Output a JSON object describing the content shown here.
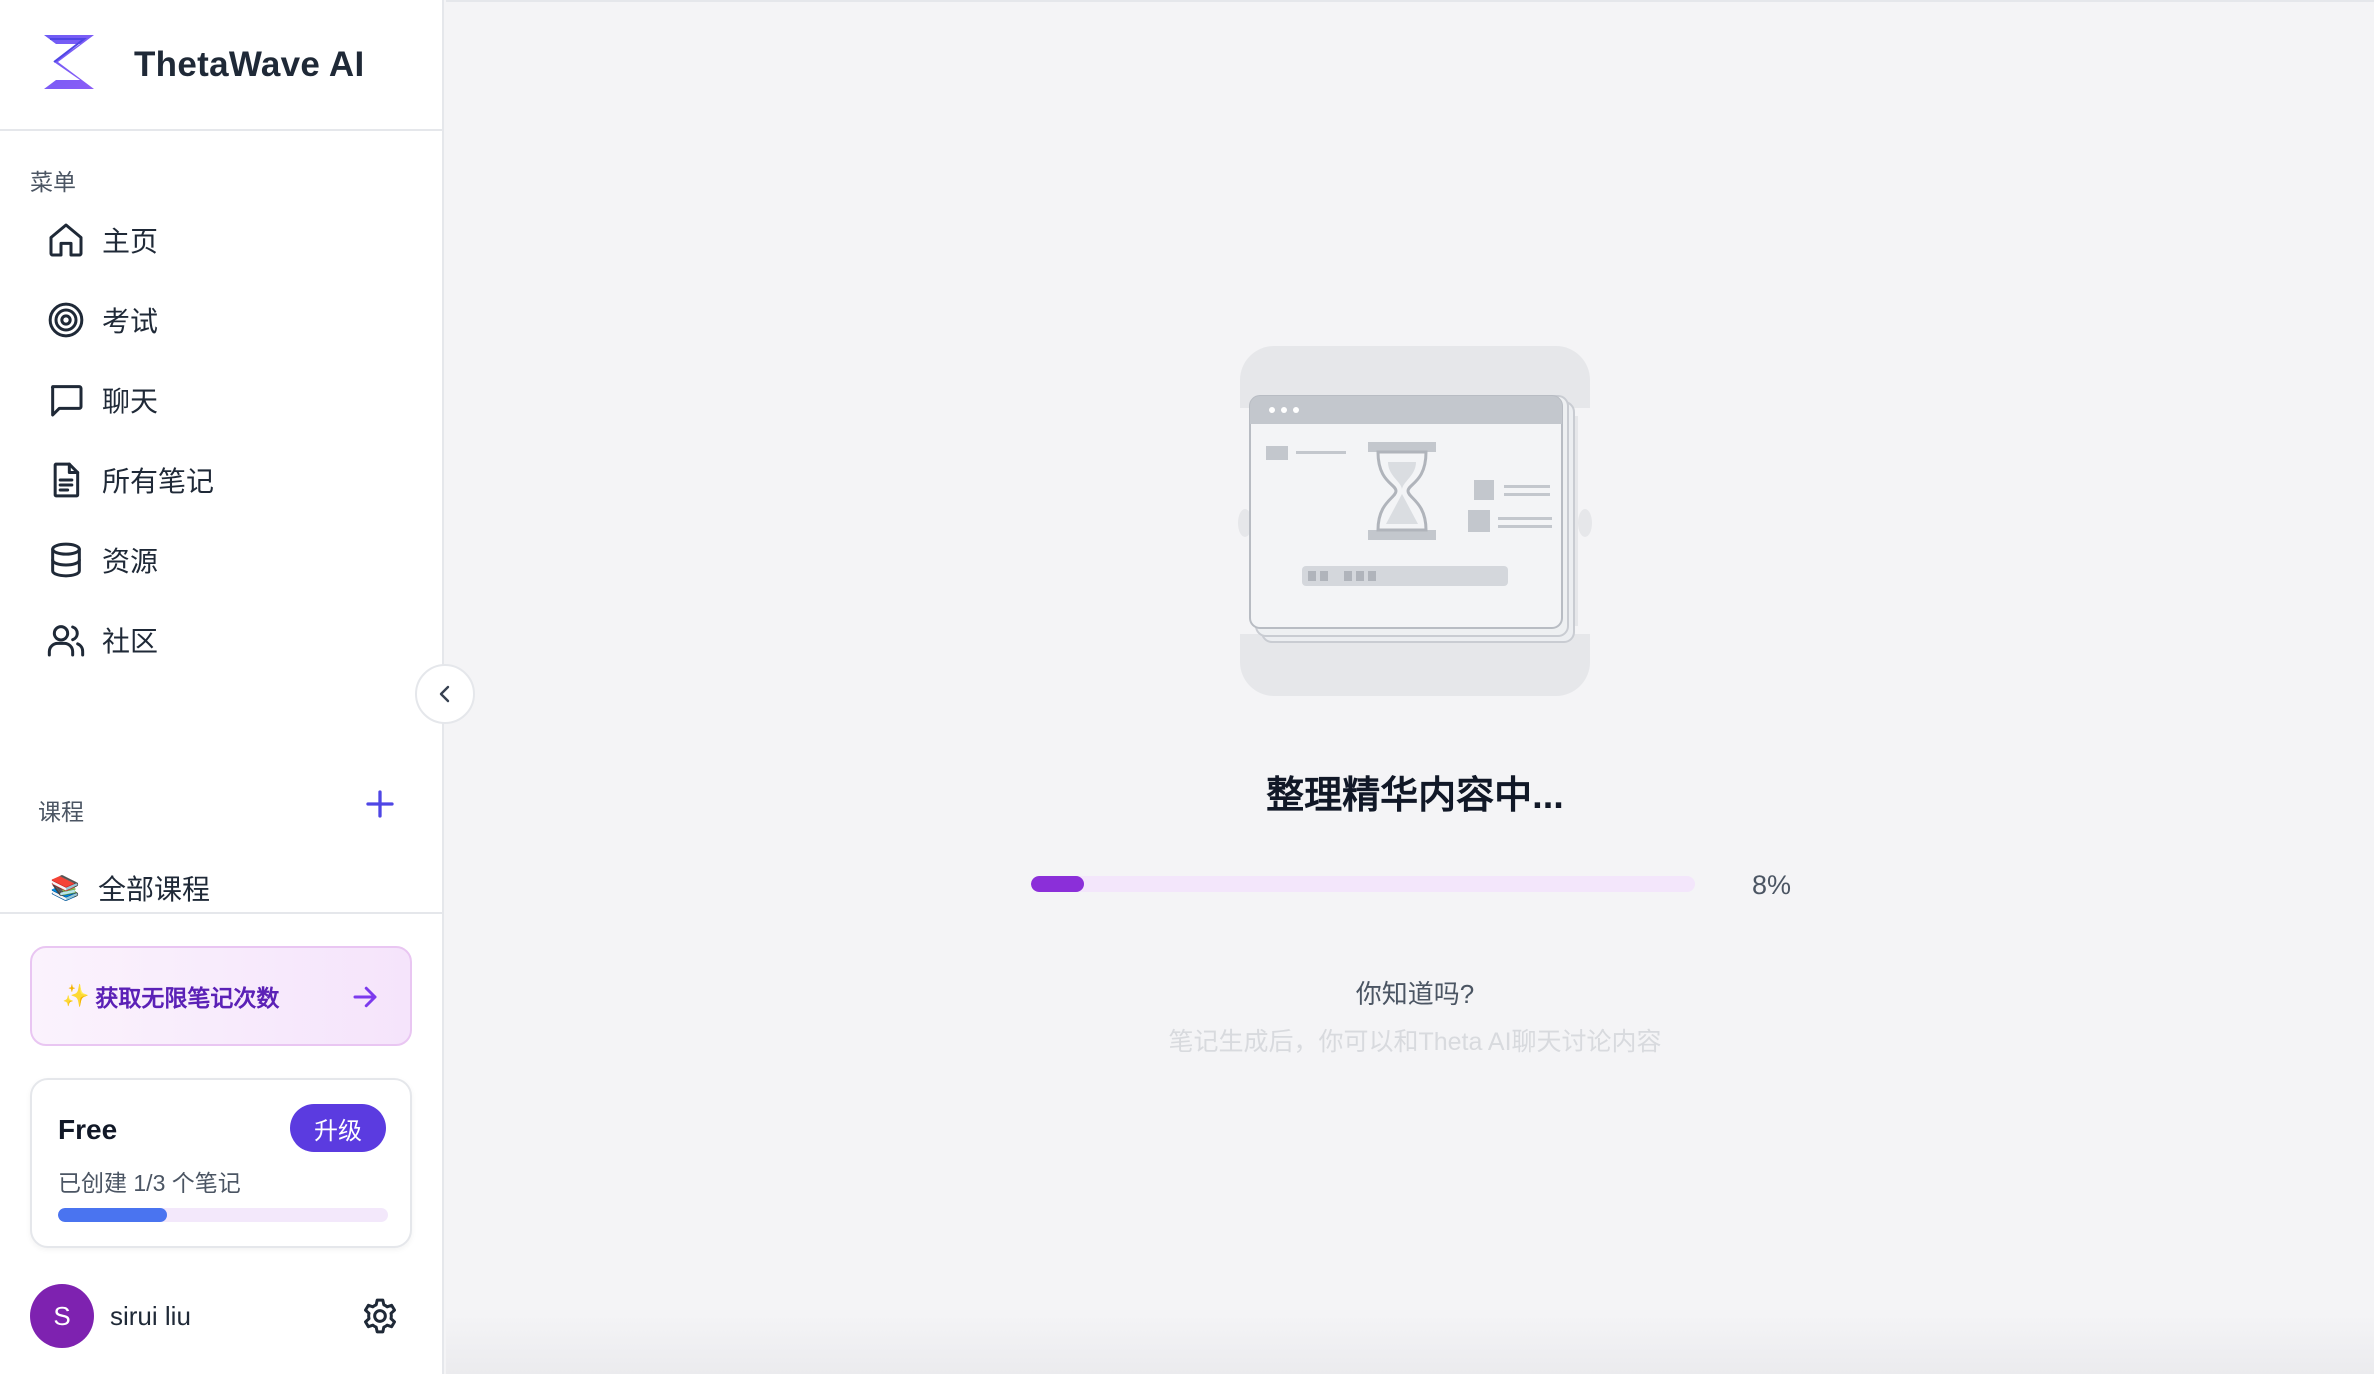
{
  "brand": {
    "name": "ThetaWave AI"
  },
  "sidebar": {
    "menu_label": "菜单",
    "items": [
      {
        "label": "主页",
        "icon": "home-icon"
      },
      {
        "label": "考试",
        "icon": "target-icon"
      },
      {
        "label": "聊天",
        "icon": "chat-icon"
      },
      {
        "label": "所有笔记",
        "icon": "document-icon"
      },
      {
        "label": "资源",
        "icon": "database-icon"
      },
      {
        "label": "社区",
        "icon": "users-icon"
      }
    ],
    "courses_label": "课程",
    "course_items": [
      {
        "label": "全部课程",
        "icon": "books-icon"
      }
    ]
  },
  "promo": {
    "sparkle": "✨",
    "label": "获取无限笔记次数"
  },
  "plan": {
    "name": "Free",
    "upgrade_label": "升级",
    "usage_text": "已创建 1/3 个笔记",
    "usage_fraction": 0.33
  },
  "user": {
    "initial": "S",
    "name": "sirui liu"
  },
  "main": {
    "status_title": "整理精华内容中...",
    "progress_percent": 8,
    "progress_label": "8%",
    "tip_title": "你知道吗?",
    "tip_text": "笔记生成后，你可以和Theta AI聊天讨论内容"
  },
  "colors": {
    "accent": "#5b3be0",
    "progress": "#8b2fd9",
    "plan_bar": "#4a74f0",
    "avatar": "#7e22b0"
  }
}
